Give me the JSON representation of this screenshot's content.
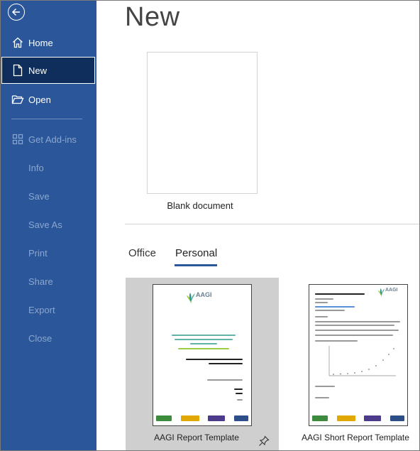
{
  "sidebar": {
    "back_icon": "back-arrow-icon",
    "items": [
      {
        "name": "home",
        "label": "Home",
        "icon": "home-icon",
        "enabled": true
      },
      {
        "name": "new",
        "label": "New",
        "icon": "new-document-icon",
        "enabled": true,
        "selected": true
      },
      {
        "name": "open",
        "label": "Open",
        "icon": "folder-open-icon",
        "enabled": true
      },
      {
        "name": "get-add-ins",
        "label": "Get Add-ins",
        "icon": "add-ins-icon",
        "enabled": false
      },
      {
        "name": "info",
        "label": "Info",
        "enabled": false
      },
      {
        "name": "save",
        "label": "Save",
        "enabled": false
      },
      {
        "name": "save-as",
        "label": "Save As",
        "enabled": false
      },
      {
        "name": "print",
        "label": "Print",
        "enabled": false
      },
      {
        "name": "share",
        "label": "Share",
        "enabled": false
      },
      {
        "name": "export",
        "label": "Export",
        "enabled": false
      },
      {
        "name": "close",
        "label": "Close",
        "enabled": false
      }
    ],
    "colors": {
      "background": "#2b579a",
      "selected": "#0f2e5b",
      "disabled_text": "#8ba6cf"
    }
  },
  "main": {
    "title": "New",
    "blank": {
      "label": "Blank document"
    },
    "tabs": [
      {
        "name": "office",
        "label": "Office",
        "active": false
      },
      {
        "name": "personal",
        "label": "Personal",
        "active": true
      }
    ],
    "templates": [
      {
        "label": "AAGI Report Template",
        "selected": true,
        "pinned": true,
        "logo_text": "AAGI"
      },
      {
        "label": "AAGI Short Report Template",
        "selected": false,
        "pinned": false,
        "logo_text": "AAGI"
      }
    ]
  }
}
